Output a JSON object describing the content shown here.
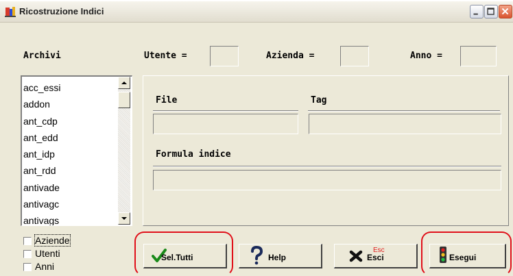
{
  "window": {
    "title": "Ricostruzione Indici"
  },
  "titlebar_buttons": {
    "minimize_icon": "minimize-icon",
    "maximize_icon": "maximize-icon",
    "close_icon": "close-icon"
  },
  "header": {
    "archivi_label": "Archivi",
    "utente_label": "Utente =",
    "utente_value": "",
    "azienda_label": "Azienda =",
    "azienda_value": "",
    "anno_label": "Anno =",
    "anno_value": ""
  },
  "archivi_list": {
    "items": [
      "acc_essi",
      "addon",
      "ant_cdp",
      "ant_edd",
      "ant_idp",
      "ant_rdd",
      "antivade",
      "antivagc",
      "antivags"
    ]
  },
  "detail": {
    "file_label": "File",
    "file_value": "",
    "tag_label": "Tag",
    "tag_value": "",
    "formula_label": "Formula indice",
    "formula_value": ""
  },
  "checkboxes": [
    {
      "label": "Aziende",
      "checked": false
    },
    {
      "label": "Utenti",
      "checked": false
    },
    {
      "label": "Anni",
      "checked": false
    }
  ],
  "buttons": {
    "sel_tutti": "Sel.Tutti",
    "help": "Help",
    "esci": "Esci",
    "esci_shortcut": "Esc",
    "esegui": "Esegui"
  },
  "colors": {
    "highlight_red": "#e0101a",
    "window_bg": "#ece9d8",
    "esc_red": "#e02020"
  }
}
